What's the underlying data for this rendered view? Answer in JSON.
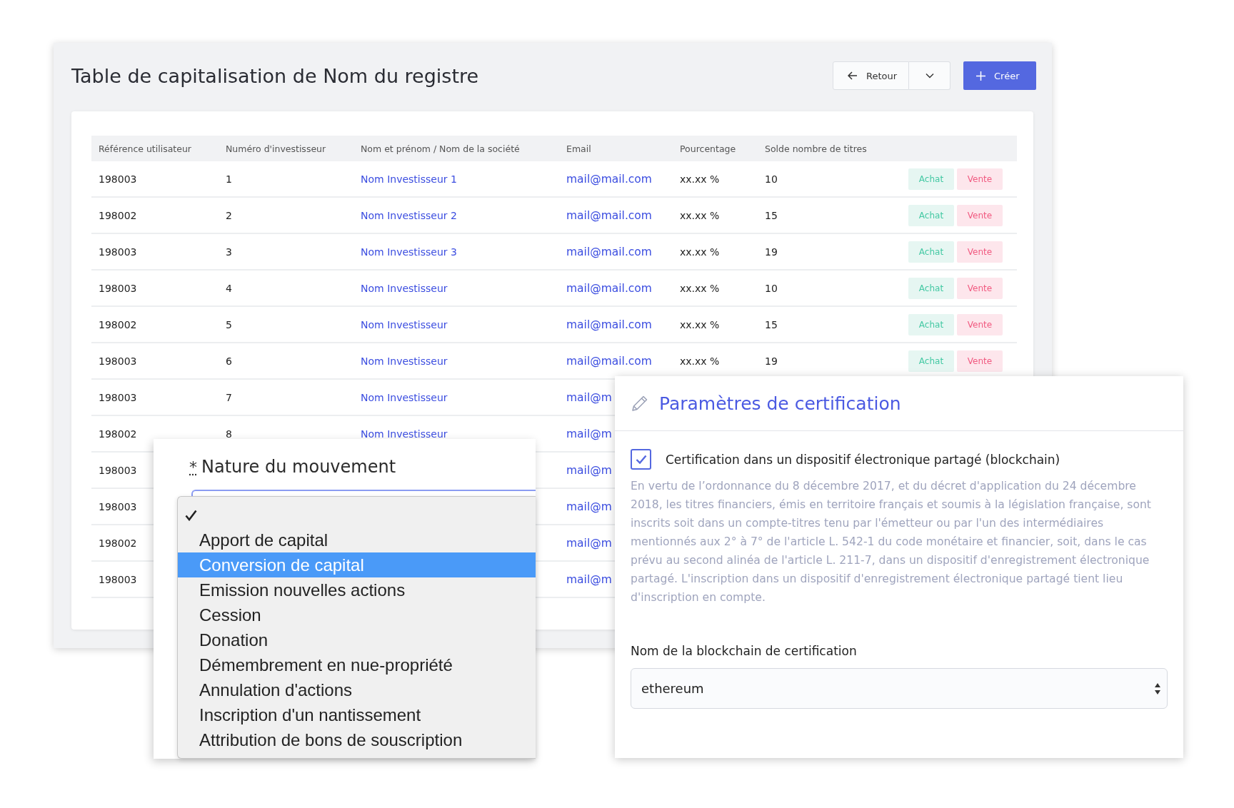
{
  "cap_table": {
    "title": "Table de capitalisation de Nom du registre",
    "buttons": [
      {
        "kind": "back",
        "label": "Retour"
      },
      {
        "kind": "menu"
      },
      {
        "kind": "create",
        "label": "Créer"
      }
    ],
    "table": {
      "columns": [
        "Référence utilisateur",
        "Numéro d'investisseur",
        "Nom et prénom / Nom de la société",
        "Email",
        "Pourcentage",
        "Solde nombre de titres"
      ],
      "rows": [
        {
          "reference": "198003",
          "number": "1",
          "name": "Nom Investisseur 1",
          "email": "mail@mail.com",
          "percentage": "xx.xx %",
          "balance": "10",
          "actions": [
            {
              "kind": "buy",
              "label": "Achat"
            },
            {
              "kind": "sell",
              "label": "Vente"
            }
          ]
        },
        {
          "reference": "198002",
          "number": "2",
          "name": "Nom Investisseur 2",
          "email": "mail@mail.com",
          "percentage": "xx.xx %",
          "balance": "15",
          "actions": [
            {
              "kind": "buy",
              "label": "Achat"
            },
            {
              "kind": "sell",
              "label": "Vente"
            }
          ]
        },
        {
          "reference": "198003",
          "number": "3",
          "name": "Nom Investisseur 3",
          "email": "mail@mail.com",
          "percentage": "xx.xx %",
          "balance": "19",
          "actions": [
            {
              "kind": "buy",
              "label": "Achat"
            },
            {
              "kind": "sell",
              "label": "Vente"
            }
          ]
        },
        {
          "reference": "198003",
          "number": "4",
          "name": "Nom Investisseur",
          "email": "mail@mail.com",
          "percentage": "xx.xx %",
          "balance": "10",
          "actions": [
            {
              "kind": "buy",
              "label": "Achat"
            },
            {
              "kind": "sell",
              "label": "Vente"
            }
          ]
        },
        {
          "reference": "198002",
          "number": "5",
          "name": "Nom Investisseur",
          "email": "mail@mail.com",
          "percentage": "xx.xx %",
          "balance": "15",
          "actions": [
            {
              "kind": "buy",
              "label": "Achat"
            },
            {
              "kind": "sell",
              "label": "Vente"
            }
          ]
        },
        {
          "reference": "198003",
          "number": "6",
          "name": "Nom Investisseur",
          "email": "mail@mail.com",
          "percentage": "xx.xx %",
          "balance": "19",
          "actions": [
            {
              "kind": "buy",
              "label": "Achat"
            },
            {
              "kind": "sell",
              "label": "Vente"
            }
          ]
        },
        {
          "reference": "198003",
          "number": "7",
          "name": "Nom Investisseur",
          "email": "mail@m"
        },
        {
          "reference": "198002",
          "number": "8",
          "name": "Nom Investisseur",
          "email": "mail@m"
        },
        {
          "reference": "198003",
          "email": "mail@m"
        },
        {
          "reference": "198003",
          "email": "mail@m"
        },
        {
          "reference": "198002",
          "email": "mail@m"
        },
        {
          "reference": "198003",
          "email": "mail@m"
        }
      ]
    }
  },
  "movement_form": {
    "required_mark": "*",
    "label": "Nature du mouvement",
    "options": [
      {
        "checked": true,
        "selected": false
      },
      {
        "label": "Apport de capital",
        "checked": false,
        "selected": false
      },
      {
        "label": "Conversion de capital",
        "checked": false,
        "selected": true
      },
      {
        "label": "Emission nouvelles actions",
        "checked": false,
        "selected": false
      },
      {
        "label": "Cession",
        "checked": false,
        "selected": false
      },
      {
        "label": "Donation",
        "checked": false,
        "selected": false
      },
      {
        "label": "Démembrement en nue-propriété",
        "checked": false,
        "selected": false
      },
      {
        "label": "Annulation d'actions",
        "checked": false,
        "selected": false
      },
      {
        "label": "Inscription d'un nantissement",
        "checked": false,
        "selected": false
      },
      {
        "label": "Attribution de bons de souscription",
        "checked": false,
        "selected": false
      }
    ]
  },
  "certification": {
    "title": "Paramètres de certification",
    "checkbox": {
      "label": "Certification dans un dispositif électronique partagé (blockchain)",
      "checked": true
    },
    "notice": "En vertu de l’ordonnance du 8 décembre 2017, et du décret d'application du 24 décembre 2018, les titres financiers, émis en territoire français et soumis à la législation française, sont inscrits soit dans un compte-titres tenu par l'émetteur ou par l'un des intermédiaires mentionnés aux 2° à 7° de l'article L. 542-1 du code monétaire et financier, soit, dans le cas prévu au second alinéa de l'article L. 211-7, dans un dispositif d'enregistrement électronique partagé. L'inscription dans un dispositif d'enregistrement électronique partagé tient lieu d'inscription en compte.",
    "blockchain_label": "Nom de la blockchain de certification",
    "blockchain_value": "ethereum"
  }
}
